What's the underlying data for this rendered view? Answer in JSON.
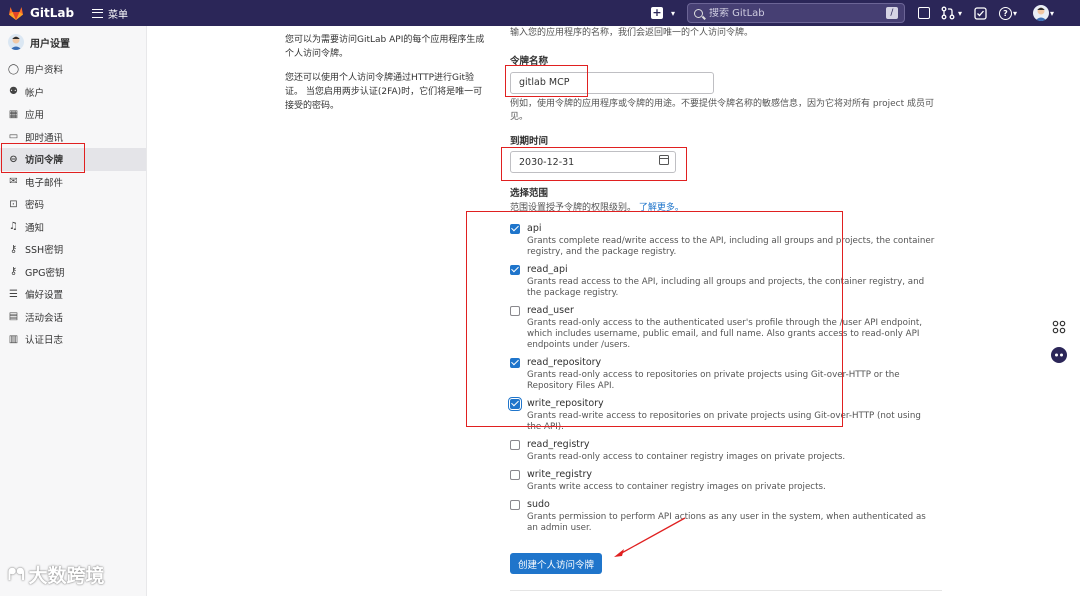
{
  "topbar": {
    "brand": "GitLab",
    "menu_label": "菜单",
    "search_placeholder": "搜索 GitLab",
    "search_shortcut": "/",
    "help_label": "?"
  },
  "sidebar": {
    "title": "用户设置",
    "items": [
      {
        "label": "用户资料",
        "icon": "user-icon"
      },
      {
        "label": "帐户",
        "icon": "account-icon"
      },
      {
        "label": "应用",
        "icon": "applications-icon"
      },
      {
        "label": "即时通讯",
        "icon": "chat-icon"
      },
      {
        "label": "访问令牌",
        "icon": "token-icon",
        "active": true
      },
      {
        "label": "电子邮件",
        "icon": "mail-icon"
      },
      {
        "label": "密码",
        "icon": "lock-icon"
      },
      {
        "label": "通知",
        "icon": "bell-icon"
      },
      {
        "label": "SSH密钥",
        "icon": "key-icon"
      },
      {
        "label": "GPG密钥",
        "icon": "key-icon"
      },
      {
        "label": "偏好设置",
        "icon": "preferences-icon"
      },
      {
        "label": "活动会话",
        "icon": "sessions-icon"
      },
      {
        "label": "认证日志",
        "icon": "log-icon"
      }
    ],
    "watermark": "大数跨境"
  },
  "description": {
    "p1": "您可以为需要访问GitLab API的每个应用程序生成个人访问令牌。",
    "p2": "您还可以使用个人访问令牌通过HTTP进行Git验证。 当您启用两步认证(2FA)时，它们将是唯一可接受的密码。"
  },
  "form": {
    "intro": "输入您的应用程序的名称，我们会返回唯一的个人访问令牌。",
    "name_label": "令牌名称",
    "name_value": "gitlab MCP",
    "name_hint": "例如，使用令牌的应用程序或令牌的用途。不要提供令牌名称的敏感信息，因为它将对所有 project 成员可见。",
    "expiry_label": "到期时间",
    "expiry_value": "2030-12-31",
    "scopes_label": "选择范围",
    "scopes_hint": "范围设置授予令牌的权限级别。",
    "scopes_link": "了解更多。",
    "submit_label": "创建个人访问令牌"
  },
  "scopes": [
    {
      "name": "api",
      "checked": true,
      "desc": "Grants complete read/write access to the API, including all groups and projects, the container registry, and the package registry."
    },
    {
      "name": "read_api",
      "checked": true,
      "desc": "Grants read access to the API, including all groups and projects, the container registry, and the package registry."
    },
    {
      "name": "read_user",
      "checked": false,
      "desc": "Grants read-only access to the authenticated user's profile through the /user API endpoint, which includes username, public email, and full name. Also grants access to read-only API endpoints under /users."
    },
    {
      "name": "read_repository",
      "checked": true,
      "desc": "Grants read-only access to repositories on private projects using Git-over-HTTP or the Repository Files API."
    },
    {
      "name": "write_repository",
      "checked": true,
      "desc": "Grants read-write access to repositories on private projects using Git-over-HTTP (not using the API)."
    },
    {
      "name": "read_registry",
      "checked": false,
      "desc": "Grants read-only access to container registry images on private projects."
    },
    {
      "name": "write_registry",
      "checked": false,
      "desc": "Grants write access to container registry images on private projects."
    },
    {
      "name": "sudo",
      "checked": false,
      "desc": "Grants permission to perform API actions as any user in the system, when authenticated as an admin user."
    }
  ],
  "colors": {
    "topbar": "#2b2658",
    "primary": "#1f75cb",
    "annotation": "#e02020"
  }
}
